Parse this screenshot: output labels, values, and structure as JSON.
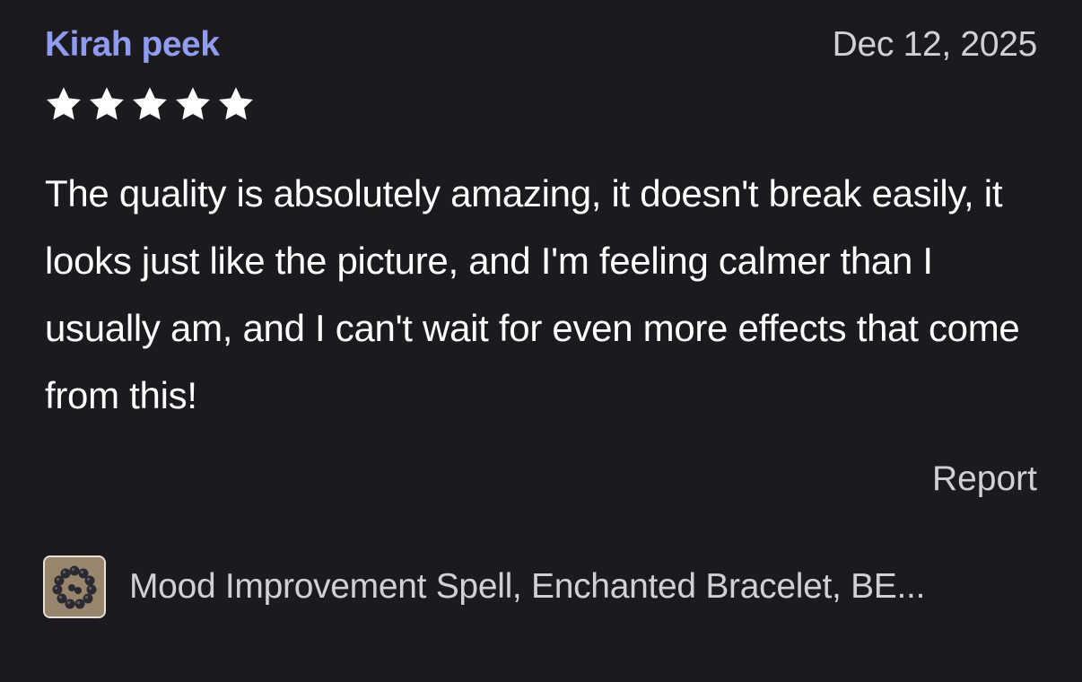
{
  "review": {
    "reviewer_name": "Kirah peek",
    "date": "Dec 12, 2025",
    "rating": 5,
    "rating_max": 5,
    "body": "The quality is absolutely amazing, it doesn't break easily, it looks just like the picture, and I'm feeling calmer than I usually am, and I can't wait for even more effects that come from this!",
    "report_label": "Report"
  },
  "product": {
    "title": "Mood Improvement Spell, Enchanted Bracelet, BE...",
    "thumbnail_icon": "bracelet-thumbnail"
  },
  "colors": {
    "background": "#1c1a1f",
    "reviewer_name": "#8f9cf0",
    "secondary_text": "#d3cfd8",
    "primary_text": "#ffffff",
    "star": "#ffffff"
  }
}
